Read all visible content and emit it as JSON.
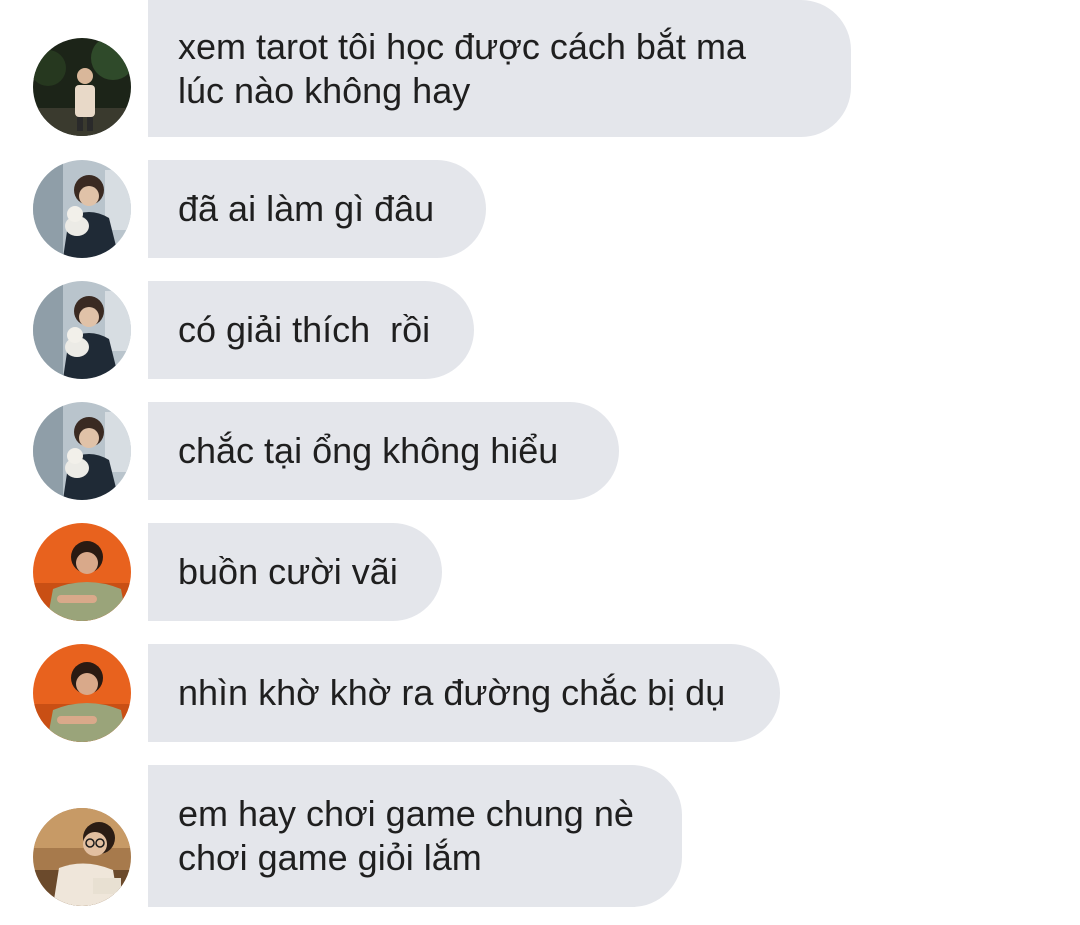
{
  "messages": [
    {
      "lines": [
        "xem tarot tôi học được cách bắt ma",
        "lúc nào không hay"
      ],
      "avatar": "avatar-person-night"
    },
    {
      "lines": [
        "đã ai làm gì đâu"
      ],
      "avatar": "avatar-person-dog"
    },
    {
      "lines": [
        "có giải thích  rồi"
      ],
      "avatar": "avatar-person-dog"
    },
    {
      "lines": [
        "chắc tại ổng không hiểu"
      ],
      "avatar": "avatar-person-dog"
    },
    {
      "lines": [
        "buồn cười vãi"
      ],
      "avatar": "avatar-person-orange"
    },
    {
      "lines": [
        "nhìn khờ khờ ra đường chắc bị dụ"
      ],
      "avatar": "avatar-person-orange"
    },
    {
      "lines": [
        "em hay chơi game chung nè",
        "chơi game giỏi lắm"
      ],
      "avatar": "avatar-person-glasses"
    }
  ],
  "colors": {
    "bubble": "#e4e6eb",
    "text": "#1f1f1f",
    "background": "#ffffff"
  }
}
